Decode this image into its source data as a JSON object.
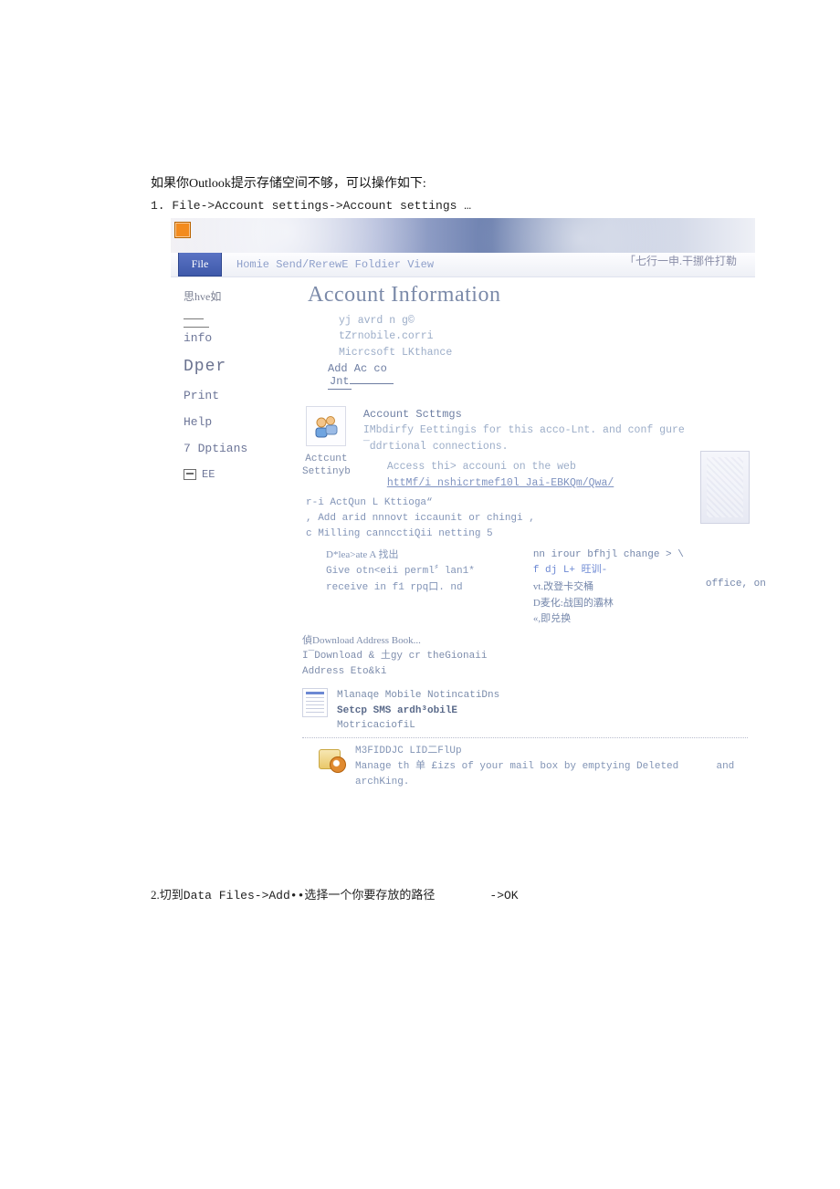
{
  "intro": "如果你Outlook提示存储空间不够，可以操作如下:",
  "step1": "1. File->Account settings->Account settings …",
  "step2_a": "2.切到",
  "step2_b": "Data Files->Add••",
  "step2_c": "选择一个你要存放的路径",
  "step2_d": "->OK",
  "tabbar": {
    "file": "File",
    "rest": "Homie Send/RerewE Foldier View",
    "search": "「七行一申.干挪件打勒"
  },
  "sidebar": {
    "i0": "思hve如",
    "i1": "info",
    "i2": "Dper",
    "i3": "Print",
    "i4": "Help",
    "i5": "7 Dptians",
    "i6": "EE"
  },
  "main": {
    "title": "Account Information",
    "acct_l1": "yj avrd n g©",
    "acct_l2": "tZrnobile.corri",
    "acct_l3": "Micrcsoft LKthance",
    "addacco_a": "Add Ac co",
    "addacco_b": "Jnt",
    "sec1_head": "Account Scttmgs",
    "sec1_body": "IMbdirfy Eettingis for this acco-Lnt. and conf gure ¯ddrtional connections.",
    "sec1_access": "Access thi> accouni on the web",
    "sec1_link": "httMf/i nshicrtmef10l Jai-EBKQm/Qwa/",
    "sec1_icon_caption1": "Actcunt",
    "sec1_icon_caption2": "Settinyb",
    "mid_l1": "r-i ActQun L Kttioga“",
    "mid_l2": ", Add arid nnnovt iccaunit or chingi ,",
    "mid_l3": "c Milling canncctiQii netting 5",
    "mid_l4a": "D*lea>ate A 找出",
    "mid_l5a": "Give otn<eii perml〞lan1*",
    "mid_l6a": "   receive in f1 rpq口. nd",
    "mid_r1": "nn irour bfhjl change > \\",
    "mid_r2": "f dj L+ 旺训-",
    "mid_r3": "vt.改登卡交桶",
    "mid_r4": "D麦化:战国的灞林",
    "mid_r5": "«,即兑换",
    "mid_office": "office, on",
    "dl_l1": "偵Download Address Book...",
    "dl_l2": "I¯Download & 土gy cr theGionaii",
    "dl_l3": "   Address Eto&ki",
    "mob_l1": "Mlanaqe Mobile NotincatiDns",
    "mob_l2": "Setcp SMS ardh³obilE",
    "mob_l3": "MotricaciofiL",
    "clean_l1": "M3FIDDJC LID二FlUp",
    "clean_l2a": "Manage th 单 £izs of your mail box by emptying Deleted",
    "clean_l2b": "and",
    "clean_l3": "archKing."
  }
}
